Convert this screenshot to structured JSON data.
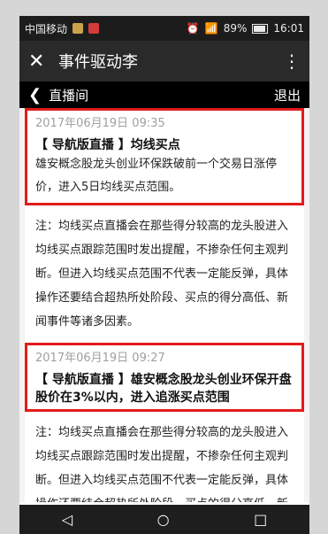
{
  "status": {
    "carrier": "中国移动",
    "battery": "89%",
    "time": "16:01"
  },
  "titlebar": {
    "title": "事件驱动李"
  },
  "subbar": {
    "title": "直播间",
    "exit": "退出"
  },
  "posts": [
    {
      "time": "2017年06月19日 09:35",
      "headline": "【 导航版直播 】均线买点",
      "body": "雄安概念股龙头创业环保跌破前一个交易日涨停价，进入5日均线买点范围。"
    },
    {
      "time": "2017年06月19日 09:27",
      "headline": "【 导航版直播 】雄安概念股龙头创业环保开盘股价在3%以内，进入追涨买点范围",
      "body": ""
    }
  ],
  "notes": [
    "注：均线买点直播会在那些得分较高的龙头股进入均线买点跟踪范围时发出提醒，不掺杂任何主观判断。但进入均线买点范围不代表一定能反弹，具体操作还要结合超热所处阶段、买点的得分高低、新闻事件等诸多因素。",
    "注：均线买点直播会在那些得分较高的龙头股进入均线买点跟踪范围时发出提醒，不掺杂任何主观判断。但进入均线买点范围不代表一定能反弹，具体操作还要结合超热所处阶段、买点的得分高低、新"
  ]
}
